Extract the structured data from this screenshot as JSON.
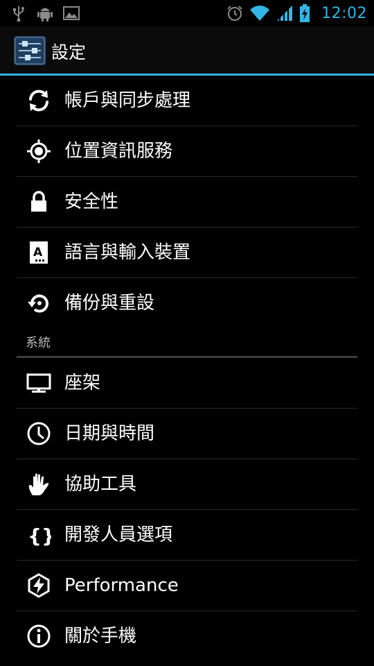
{
  "status_bar": {
    "time": "12:02",
    "left_icons": [
      "usb-icon",
      "android-debug-icon",
      "picture-icon"
    ],
    "right_icons": [
      "alarm-icon",
      "wifi-icon",
      "signal-icon",
      "battery-charging-icon"
    ]
  },
  "action_bar": {
    "title": "設定",
    "icon": "settings-sliders-icon"
  },
  "colors": {
    "accent": "#33b5e5",
    "background": "#000000",
    "divider": "#2a2a2a",
    "section_text": "#bdbdbd"
  },
  "settings": {
    "group1": [
      {
        "label": "帳戶與同步處理",
        "icon": "sync-icon"
      },
      {
        "label": "位置資訊服務",
        "icon": "location-icon"
      },
      {
        "label": "安全性",
        "icon": "lock-icon"
      },
      {
        "label": "語言與輸入裝置",
        "icon": "language-keyboard-icon"
      },
      {
        "label": "備份與重設",
        "icon": "backup-restore-icon"
      }
    ],
    "section_title": "系統",
    "group2": [
      {
        "label": "座架",
        "icon": "dock-monitor-icon"
      },
      {
        "label": "日期與時間",
        "icon": "clock-icon"
      },
      {
        "label": "協助工具",
        "icon": "hand-icon"
      },
      {
        "label": "開發人員選項",
        "icon": "braces-icon"
      },
      {
        "label": "Performance",
        "icon": "performance-bolt-icon"
      },
      {
        "label": "關於手機",
        "icon": "info-icon"
      }
    ]
  }
}
